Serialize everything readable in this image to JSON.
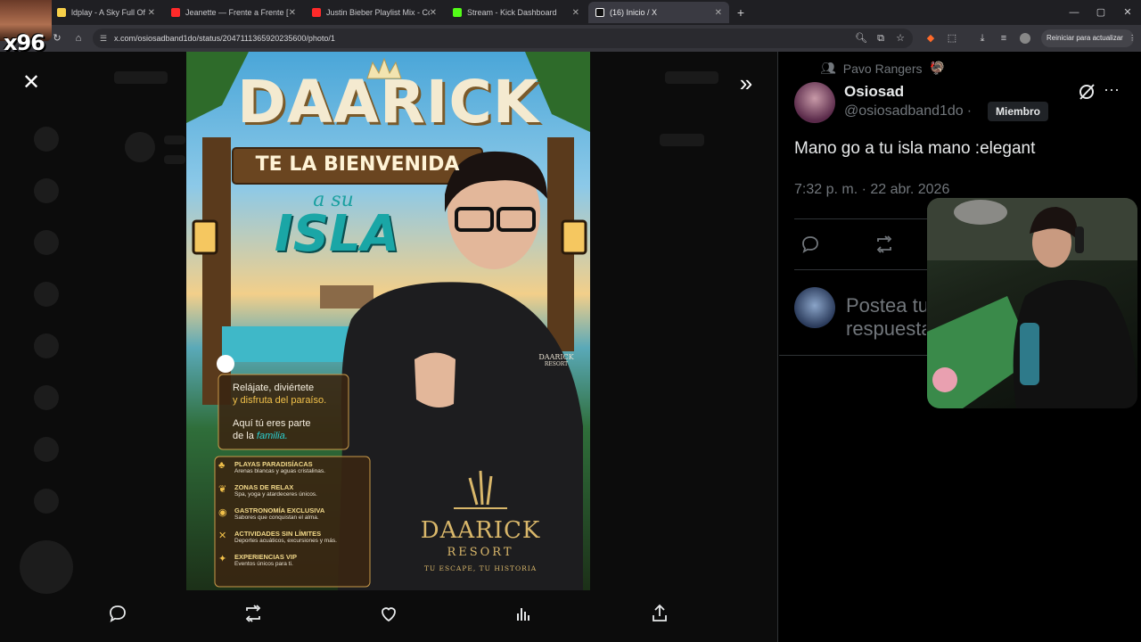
{
  "browser": {
    "tabs": [
      {
        "label": "ldplay - A Sky Full Of Stars (",
        "favicon_color": "#f7d04a",
        "active": false
      },
      {
        "label": "Jeanette — Frente a Frente [Le",
        "favicon_color": "#ff2a2a",
        "active": false
      },
      {
        "label": "Justin Bieber Playlist Mix - Com",
        "favicon_color": "#ff2a2a",
        "active": false
      },
      {
        "label": "Stream - Kick Dashboard",
        "favicon_color": "#53fc18",
        "active": false
      },
      {
        "label": "(16) Inicio / X",
        "favicon_color": "#ffffff",
        "active": true
      }
    ],
    "tab_close": "✕",
    "new_tab": "+",
    "window_min": "—",
    "window_max": "▢",
    "window_close": "✕",
    "url": "x.com/osiosadband1do/status/2047111365920235600/photo/1",
    "restart_label": "Reiniciar para actualizar"
  },
  "overlay": {
    "badge": "x96"
  },
  "poster": {
    "title": "DAARICK",
    "banner": "TE LA BIENVENIDA",
    "subtitle": "a su",
    "island": "ISLA",
    "relax_line1": "Relájate, diviértete",
    "relax_line2": "y disfruta del paraíso.",
    "family_line1": "Aquí tú eres parte",
    "family_line2_prefix": "de la ",
    "family_line2_em": "familia.",
    "shirt_logo": "DAARICK",
    "shirt_logo_sub": "RESORT",
    "features": [
      {
        "title": "PLAYAS PARADISÍACAS",
        "desc": "Arenas blancas y aguas cristalinas."
      },
      {
        "title": "ZONAS DE RELAX",
        "desc": "Spa, yoga y atardeceres únicos."
      },
      {
        "title": "GASTRONOMÍA EXCLUSIVA",
        "desc": "Sabores que conquistan el alma."
      },
      {
        "title": "ACTIVIDADES SIN LÍMITES",
        "desc": "Deportes acuáticos, excursiones y más."
      },
      {
        "title": "EXPERIENCIAS VIP",
        "desc": "Eventos únicos para ti."
      }
    ],
    "brand": "DAARICK",
    "brand_sub": "RESORT",
    "tagline": "TU ESCAPE, TU HISTORIA"
  },
  "viewer": {
    "close_icon": "✕",
    "next_icon": "»"
  },
  "tweet": {
    "community": "Pavo Rangers",
    "community_emoji": "🦃",
    "display_name": "Osiosad",
    "handle": "@osiosadband1do",
    "separator": "·",
    "badge": "Miembro",
    "more": "···",
    "text": "Mano go a tu isla mano :elegant",
    "timestamp": "7:32 p. m. · 22 abr. 2026",
    "reply_placeholder_line1": "Postea tu",
    "reply_placeholder_line2": "respuesta"
  },
  "colors": {
    "bg": "#000000",
    "muted": "#71767b",
    "border": "#2f3336",
    "poster_gold": "#f2d98a",
    "poster_teal": "#2bb0b0"
  }
}
